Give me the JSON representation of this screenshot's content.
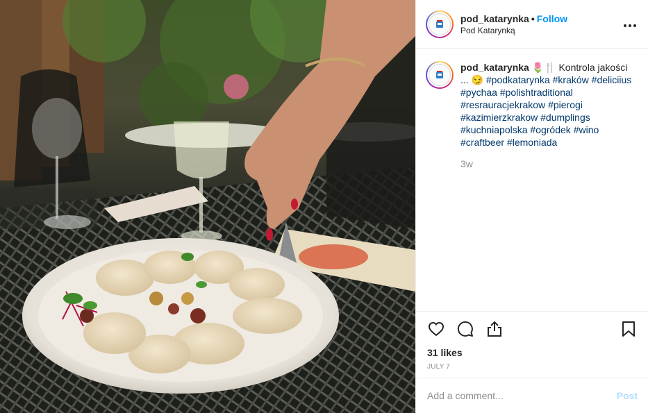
{
  "header": {
    "username": "pod_katarynka",
    "separator": "•",
    "follow_label": "Follow",
    "location": "Pod Katarynką",
    "more_icon": "more-icon"
  },
  "caption": {
    "username": "pod_katarynka",
    "text_before": " 🌷🍴 Kontrola jakości ... 😏 ",
    "hashtags": [
      "#podkatarynka",
      "#kraków",
      "#deliciius",
      "#pychaa",
      "#polishtraditional",
      "#resrauracjekrakow",
      "#pierogi",
      "#kazimierzkrakow",
      "#dumplings",
      "#kuchniapolska",
      "#ogródek",
      "#wino",
      "#craftbeer",
      "#lemoniada"
    ],
    "time": "3w"
  },
  "actions": {
    "icons": [
      "heart-icon",
      "comment-icon",
      "share-icon",
      "bookmark-icon"
    ],
    "likes": "31 likes",
    "date": "JULY 7"
  },
  "comment": {
    "placeholder": "Add a comment...",
    "post_label": "Post"
  },
  "colors": {
    "link_blue": "#0095f6",
    "hashtag": "#00376b",
    "muted": "#8e8e8e",
    "post_disabled": "#b2dffc"
  }
}
